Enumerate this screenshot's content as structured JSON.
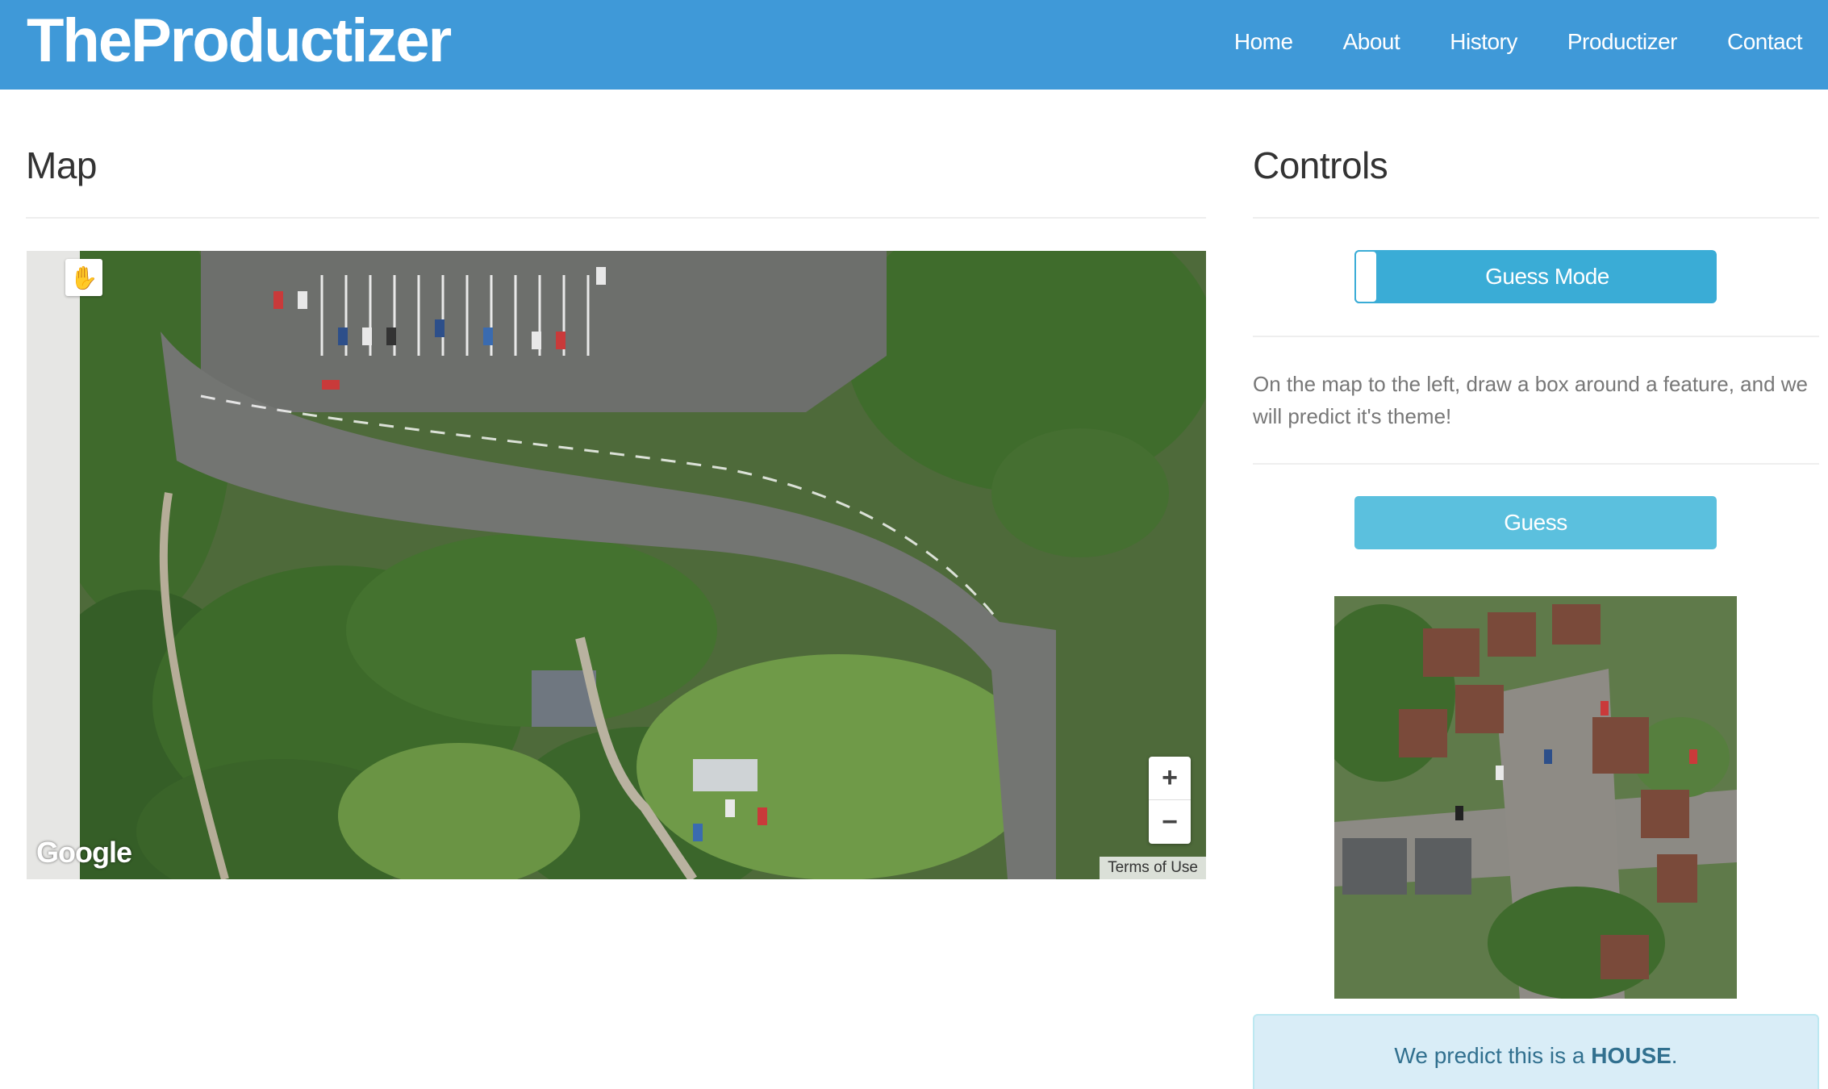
{
  "brand": "TheProductizer",
  "nav": {
    "items": [
      {
        "label": "Home"
      },
      {
        "label": "About"
      },
      {
        "label": "History"
      },
      {
        "label": "Productizer"
      },
      {
        "label": "Contact"
      }
    ]
  },
  "map": {
    "title": "Map",
    "attribution_logo": "Google",
    "terms_label": "Terms of Use",
    "zoom_in_label": "+",
    "zoom_out_label": "−",
    "pan_icon": "hand-icon"
  },
  "controls": {
    "title": "Controls",
    "toggle_label": "Guess Mode",
    "instructions": "On the map to the left, draw a box around a feature, and we will predict it's theme!",
    "guess_label": "Guess",
    "result_prefix": "We predict this is a ",
    "result_value": "HOUSE",
    "result_suffix": "."
  },
  "colors": {
    "navbar": "#3f99d8",
    "toggle": "#3aacd6",
    "guess_button": "#5bc0de",
    "alert_bg": "#d9edf7",
    "alert_text": "#31708f"
  }
}
